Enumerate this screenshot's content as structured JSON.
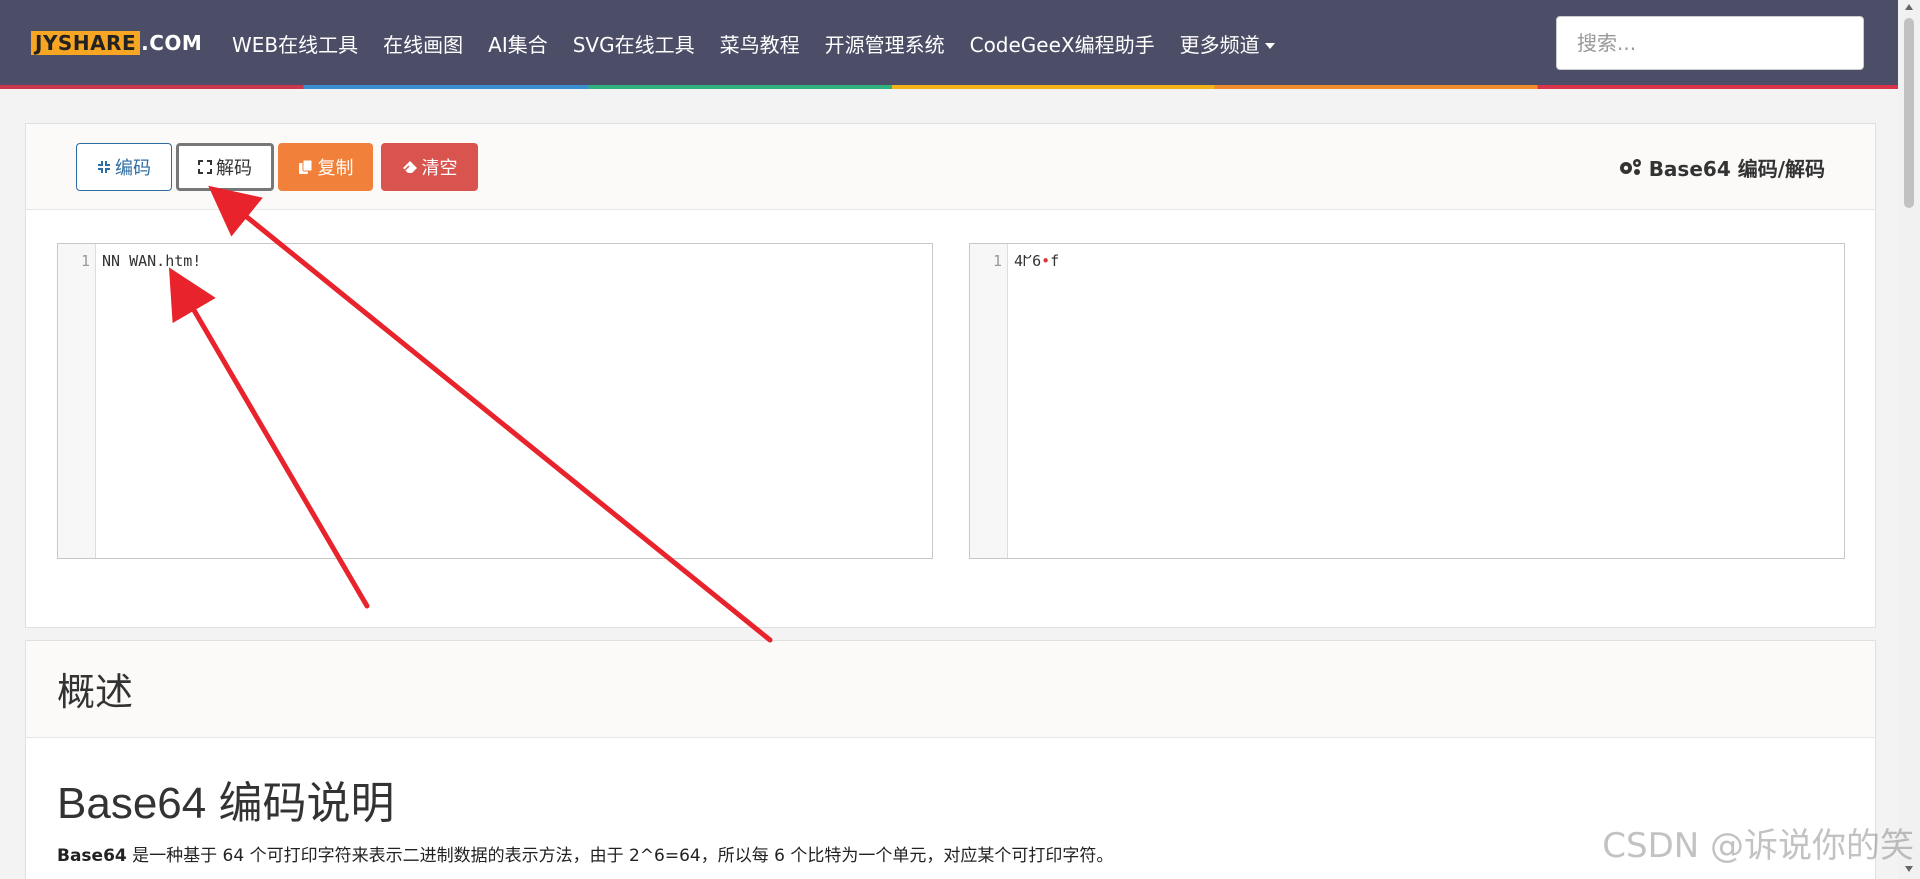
{
  "navbar": {
    "brand_main": "JYSHARE",
    "brand_tld": ".COM",
    "links": [
      "WEB在线工具",
      "在线画图",
      "AI集合",
      "SVG在线工具",
      "菜鸟教程",
      "开源管理系统",
      "CodeGeeX编程助手",
      "更多频道"
    ],
    "search_placeholder": "搜索..."
  },
  "toolbar": {
    "encode_label": "编码",
    "decode_label": "解码",
    "copy_label": "复制",
    "clear_label": "清空",
    "title": "Base64 编码/解码"
  },
  "editors": {
    "left": {
      "line": "1",
      "text": "NN WAN.htm!"
    },
    "right": {
      "line": "1",
      "text_a": "4ᖸ6",
      "text_dot": "•",
      "text_b": "f"
    }
  },
  "overview": {
    "title": "概述",
    "section_title": "Base64 编码说明",
    "text_bold": "Base64",
    "text_body": " 是一种基于 64 个可打印字符来表示二进制数据的表示方法，由于 2^6=64，所以每 6 个比特为一个单元，对应某个可打印字符。"
  },
  "watermark": "CSDN @诉说你的笑",
  "colors": {
    "navbar": "#4c4e67",
    "brand": "#f6a623",
    "copy_button": "#f0803a",
    "clear_button": "#d9534f",
    "encode_button_border": "#2e6da4",
    "annotation_arrow": "#e8232b"
  },
  "icons": {
    "encode": "compress-icon",
    "decode": "expand-icon",
    "copy": "copy-icon",
    "clear": "eraser-icon",
    "title": "gears-icon"
  }
}
